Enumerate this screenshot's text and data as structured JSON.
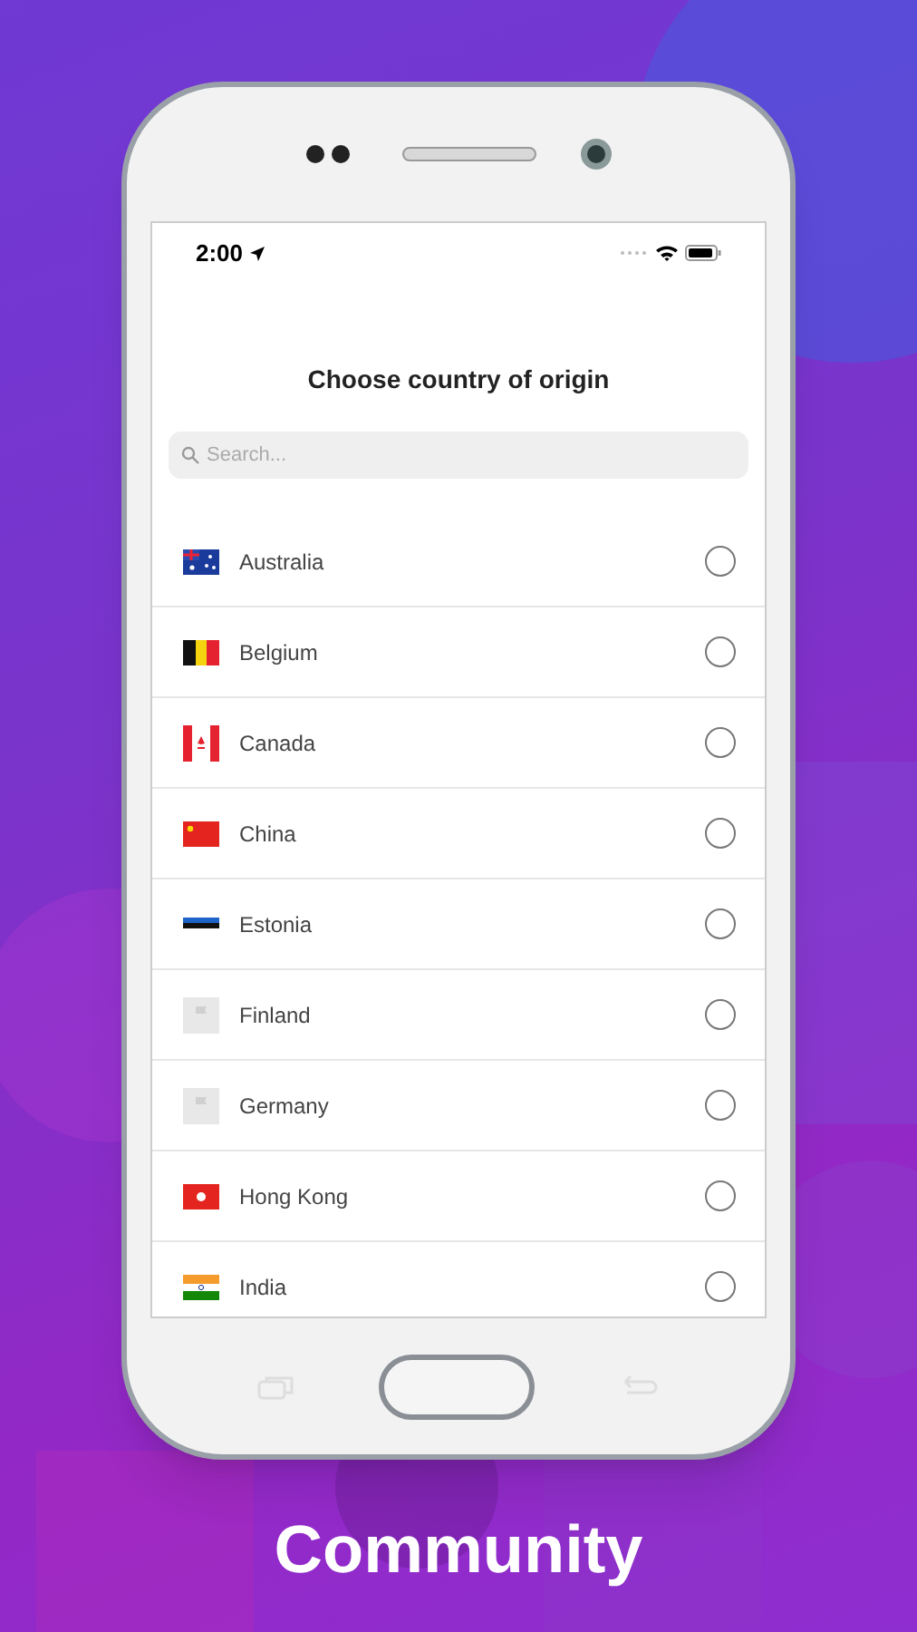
{
  "status_bar": {
    "time": "2:00"
  },
  "screen": {
    "title": "Choose country of origin",
    "search": {
      "placeholder": "Search..."
    }
  },
  "countries": [
    {
      "name": "Australia",
      "selected": false
    },
    {
      "name": "Belgium",
      "selected": false
    },
    {
      "name": "Canada",
      "selected": false
    },
    {
      "name": "China",
      "selected": false
    },
    {
      "name": "Estonia",
      "selected": false
    },
    {
      "name": "Finland",
      "selected": false
    },
    {
      "name": "Germany",
      "selected": false
    },
    {
      "name": "Hong Kong",
      "selected": false
    },
    {
      "name": "India",
      "selected": false
    }
  ],
  "caption": "Community"
}
